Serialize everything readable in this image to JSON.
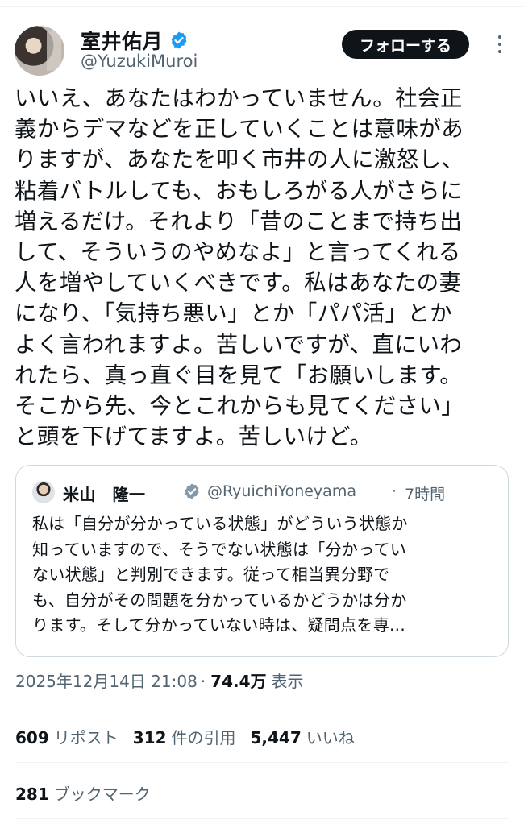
{
  "author": {
    "display_name": "室井佑月",
    "handle": "@YuzukiMuroi"
  },
  "follow_label": "フォローする",
  "tweet_lines": [
    "いいえ、あなたはわかっていません。社会正",
    "義からデマなどを正していくことは意味があ",
    "りますが、あなたを叩く市井の人に激怒し、",
    "粘着バトルしても、おもしろがる人がさらに",
    "増えるだけ。それより「昔のことまで持ち出",
    "して、そういうのやめなよ」と言ってくれる",
    "人を増やしていくべきです。私はあなたの妻",
    "になり、「気持ち悪い」とか「パパ活」とか",
    "よく言われますよ。苦しいですが、直にいわ",
    "れたら、真っ直ぐ目を見て「お願いします。",
    "そこから先、今とこれからも見てください」",
    "と頭を下げてますよ。苦しいけど。"
  ],
  "quoted": {
    "display_name": "米山　隆一",
    "handle": "@RyuichiYoneyama",
    "separator": "·",
    "time": "7時間",
    "lines": [
      "私は「自分が分かっている状態」がどういう状態か",
      "知っていますので、そうでない状態は「分かってい",
      "ない状態」と判別できます。従って相当異分野で",
      "も、自分がその問題を分かっているかどうかは分か",
      "ります。そして分かっていない時は、疑問点を専..."
    ]
  },
  "meta": {
    "timestamp": "2025年12月14日 21:08",
    "separator": "·",
    "views": "74.4万",
    "views_label": "表示"
  },
  "stats": {
    "reposts": "609",
    "reposts_label": "リポスト",
    "quotes": "312",
    "quotes_label": "件の引用",
    "likes": "5,447",
    "likes_label": "いいね",
    "bookmarks": "281",
    "bookmarks_label": "ブックマーク"
  },
  "colors": {
    "verified": "#1d9bf0",
    "text": "#0f1419",
    "secondary": "#536471",
    "border": "#cfd9de"
  },
  "icons": {
    "verified": "verified-badge-icon",
    "more": "more-dots-icon"
  }
}
